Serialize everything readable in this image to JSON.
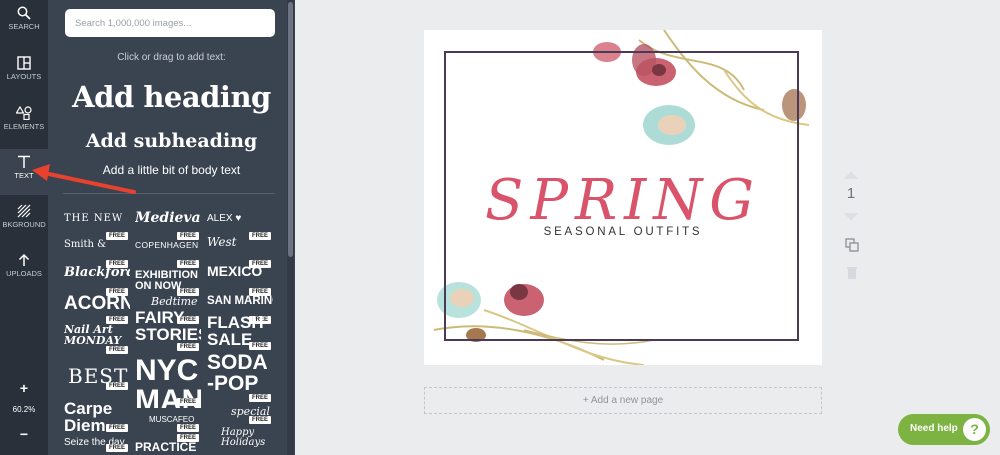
{
  "rail": {
    "items": [
      {
        "label": "SEARCH",
        "icon": "search-icon"
      },
      {
        "label": "LAYOUTS",
        "icon": "layouts-icon"
      },
      {
        "label": "ELEMENTS",
        "icon": "elements-icon"
      },
      {
        "label": "TEXT",
        "icon": "text-icon",
        "active": true
      },
      {
        "label": "BKGROUND",
        "icon": "background-icon"
      },
      {
        "label": "UPLOADS",
        "icon": "upload-icon"
      }
    ],
    "zoom_in": "+",
    "zoom_value": "60.2%",
    "zoom_out": "−"
  },
  "panel": {
    "search_placeholder": "Search 1,000,000 images...",
    "hint": "Click or drag to add text:",
    "add_heading": "Add heading",
    "add_subheading": "Add subheading",
    "add_body": "Add a little bit of body text",
    "badge": "FREE",
    "tiles": [
      {
        "text": "THE NEW"
      },
      {
        "text": "Medieval"
      },
      {
        "text": "ALEX ♥"
      },
      {
        "text": "Smith &"
      },
      {
        "text": "COPENHAGEN"
      },
      {
        "text": "West"
      },
      {
        "text": "Blackford"
      },
      {
        "text": "EXHIBITION ON NOW"
      },
      {
        "text": "MEXICO"
      },
      {
        "text": "ACORN"
      },
      {
        "text": "Bedtime"
      },
      {
        "text": "SAN MARINO"
      },
      {
        "text": "Nail Art MONDAY"
      },
      {
        "text": "FAIRY STORIES"
      },
      {
        "text": "FLASH SALE"
      },
      {
        "text": "BEST"
      },
      {
        "text": "NYC MANHATTAN"
      },
      {
        "text": "SODA -POP"
      },
      {
        "text": "Carpe Diem"
      },
      {
        "text": "MUSCAFEO"
      },
      {
        "text": "special"
      },
      {
        "text": "Seize the day"
      },
      {
        "text": "PRACTICE"
      },
      {
        "text": "Happy Holidays"
      }
    ]
  },
  "design": {
    "title": "SPRING",
    "subtitle": "SEASONAL OUTFITS",
    "title_color": "#d9536b",
    "frame_color": "#4a3a58"
  },
  "add_page": "+ Add a new page",
  "page_number": "1",
  "help": {
    "label": "Need help",
    "icon": "question-icon",
    "symbol": "?"
  },
  "colors": {
    "rail": "#293039",
    "panel": "#3a4350",
    "workspace": "#ebecee",
    "help": "#7cb342",
    "arrow": "#e8412d"
  }
}
